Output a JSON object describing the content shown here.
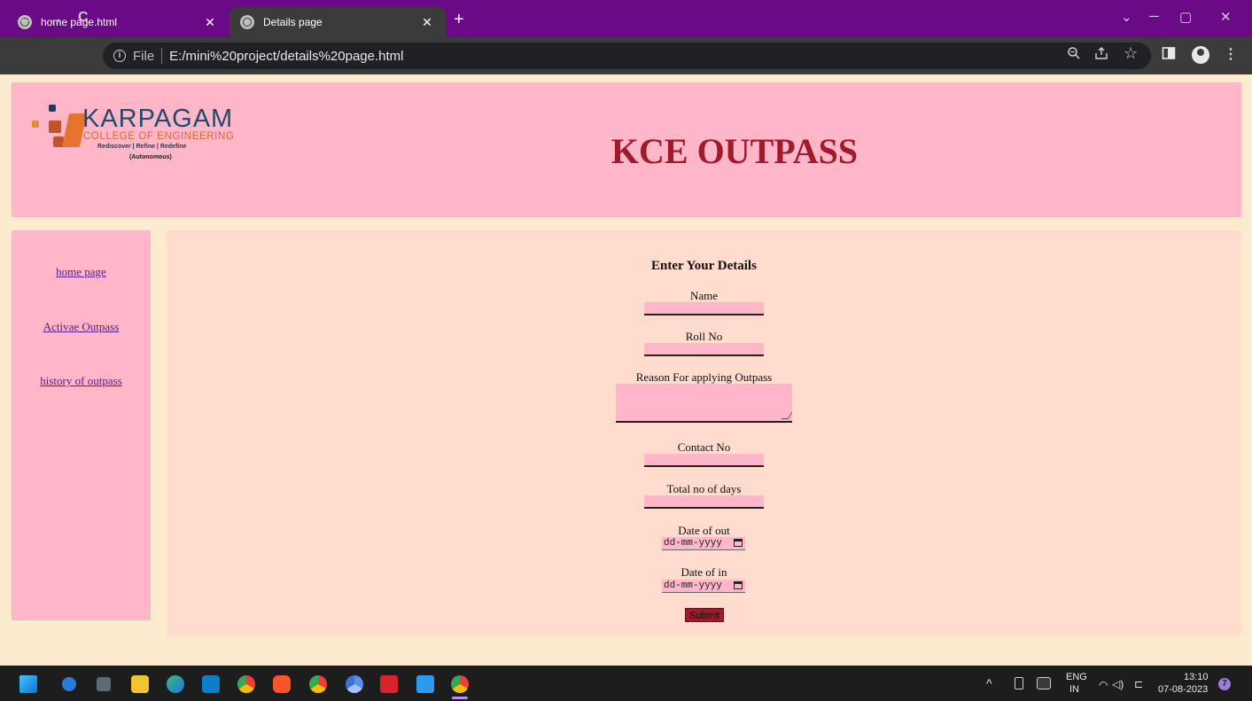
{
  "browser": {
    "tabs": [
      {
        "title": "home page.html",
        "close": "✕"
      },
      {
        "title": "Details page",
        "close": "✕"
      }
    ],
    "new_tab": "+",
    "window_controls": [
      "⌄",
      "─",
      "▢",
      "✕"
    ],
    "nav": {
      "back": "←",
      "forward": "→",
      "reload": "C"
    },
    "address": {
      "info": "i",
      "scheme": "File",
      "url": "E:/mini%20project/details%20page.html"
    },
    "toolbar_icons": [
      "zoom-icon",
      "share-icon",
      "bookmark-star-icon",
      "side-panel-icon",
      "profile-icon",
      "menu-icon"
    ],
    "colors": {
      "tab_strip": "#6a0a86",
      "toolbar": "#3b3b3b"
    }
  },
  "page": {
    "logo": {
      "name": "KARPAGAM",
      "subtitle": "COLLEGE OF ENGINEERING",
      "tagline": "Rediscover | Refine | Redefine",
      "status": "(Autonomous)"
    },
    "title": "KCE OUTPASS",
    "sidebar": {
      "links": [
        "home page",
        "Activae Outpass",
        "history of outpass"
      ]
    },
    "form": {
      "heading": "Enter Your Details",
      "fields": {
        "name": "Name",
        "roll_no": "Roll No",
        "reason": "Reason For applying Outpass",
        "contact": "Contact No",
        "days": "Total no of days",
        "date_out": "Date of out",
        "date_in": "Date of in"
      },
      "date_placeholder": "dd-mm-yyyy",
      "submit": "Submit"
    },
    "colors": {
      "background": "#fdebd0",
      "panel": "#ffb6c8",
      "content": "#ffdcce",
      "title": "#a11a2a"
    }
  },
  "taskbar": {
    "apps": [
      "windows-start-icon",
      "copilot-icon",
      "calculator-icon",
      "file-explorer-icon",
      "edge-icon",
      "store-icon",
      "chrome-icon",
      "brave-icon",
      "chrome-alt-icon",
      "chrome-dev-icon",
      "wps-icon",
      "vscode-icon",
      "chrome-active-icon"
    ],
    "tray": {
      "chevron": "^",
      "language": "ENG",
      "region": "IN",
      "time": "13:10",
      "date": "07-08-2023",
      "notifications": "7"
    }
  }
}
